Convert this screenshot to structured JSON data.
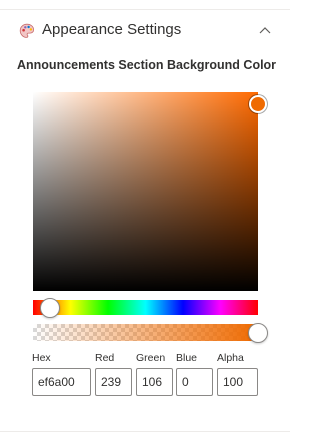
{
  "panel": {
    "title": "Appearance Settings",
    "icon": "palette-icon",
    "collapse_icon": "chevron-up-icon"
  },
  "section": {
    "label": "Announcements Section Background Color"
  },
  "color_picker": {
    "hue_color": "#ff6a00",
    "selected_color": "#ef6a00",
    "saturation": 1.0,
    "value": 0.94,
    "hue_degrees": 27,
    "alpha_percent": 100
  },
  "fields": {
    "hex": {
      "label": "Hex",
      "value": "ef6a00"
    },
    "red": {
      "label": "Red",
      "value": "239"
    },
    "green": {
      "label": "Green",
      "value": "106"
    },
    "blue": {
      "label": "Blue",
      "value": "0"
    },
    "alpha": {
      "label": "Alpha",
      "value": "100"
    }
  }
}
